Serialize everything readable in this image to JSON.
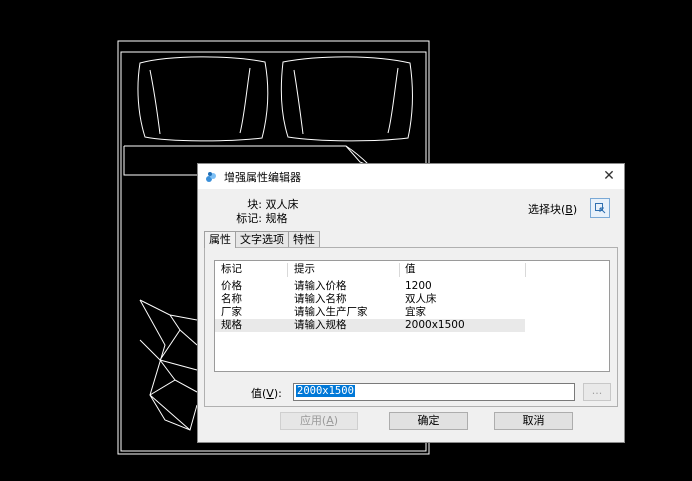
{
  "dialog": {
    "title": "增强属性编辑器",
    "block_label": "块:",
    "block_value": "双人床",
    "tag_label": "标记:",
    "tag_value": "规格",
    "select_block_label": "选择块(",
    "select_block_key": "B",
    "select_block_suffix": ")",
    "close_glyph": "✕"
  },
  "tabs": [
    "属性",
    "文字选项",
    "特性"
  ],
  "attributes": {
    "columns": [
      "标记",
      "提示",
      "值"
    ],
    "rows": [
      {
        "tag": "价格",
        "prompt": "请输入价格",
        "value": "1200"
      },
      {
        "tag": "名称",
        "prompt": "请输入名称",
        "value": "双人床"
      },
      {
        "tag": "厂家",
        "prompt": "请输入生产厂家",
        "value": "宜家"
      },
      {
        "tag": "规格",
        "prompt": "请输入规格",
        "value": "2000x1500"
      }
    ],
    "selected_index": 3
  },
  "value_field": {
    "label": "值(",
    "key": "V",
    "suffix": "):",
    "value": "2000x1500",
    "ellipsis": "..."
  },
  "buttons": {
    "apply": "应用(",
    "apply_key": "A",
    "apply_suffix": ")",
    "ok": "确定",
    "cancel": "取消"
  },
  "icons": {
    "app": "app-icon",
    "select": "pick-block-icon",
    "close": "close-icon"
  },
  "colors": {
    "canvas": "#000000",
    "cad_lines": "#ffffff",
    "selection": "#0078d7"
  }
}
